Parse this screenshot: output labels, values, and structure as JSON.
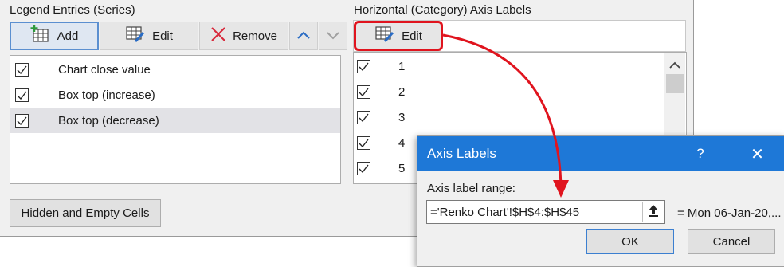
{
  "series_panel": {
    "title": "Legend Entries (Series)",
    "buttons": {
      "add": "Add",
      "edit": "Edit",
      "remove": "Remove"
    },
    "items": [
      {
        "label": "Chart close value",
        "checked": true,
        "selected": false
      },
      {
        "label": "Box top (increase)",
        "checked": true,
        "selected": false
      },
      {
        "label": "Box top (decrease)",
        "checked": true,
        "selected": true
      }
    ],
    "hidden_cells_button": "Hidden and Empty Cells"
  },
  "category_panel": {
    "title": "Horizontal (Category) Axis Labels",
    "edit_button": "Edit",
    "items": [
      {
        "label": "1",
        "checked": true
      },
      {
        "label": "2",
        "checked": true
      },
      {
        "label": "3",
        "checked": true
      },
      {
        "label": "4",
        "checked": true
      },
      {
        "label": "5",
        "checked": true
      }
    ]
  },
  "axis_labels_dialog": {
    "title": "Axis Labels",
    "help": "?",
    "close": "✕",
    "range_label": "Axis label range:",
    "range_value": "='Renko Chart'!$H$4:$H$45",
    "preview": "= Mon 06-Jan-20,...",
    "ok": "OK",
    "cancel": "Cancel"
  },
  "annotation": {
    "color": "#e0141e"
  },
  "icons": {
    "add": "add-table-icon",
    "edit": "edit-table-icon",
    "remove": "remove-x-icon",
    "up": "chevron-up-icon",
    "down": "chevron-down-icon",
    "collapse": "collapse-dialog-icon"
  }
}
